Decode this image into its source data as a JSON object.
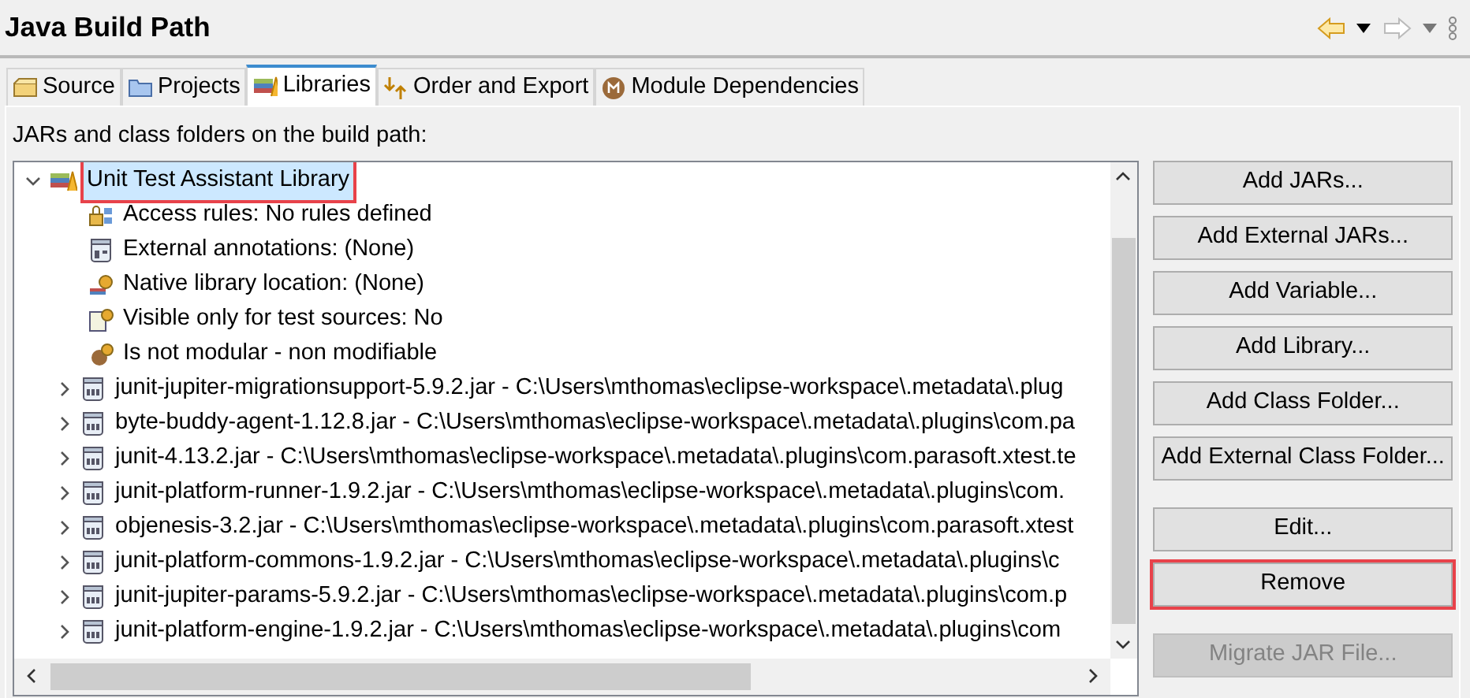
{
  "header": {
    "title": "Java Build Path"
  },
  "tabs": [
    {
      "label": "Source",
      "kind": "source",
      "selected": false
    },
    {
      "label": "Projects",
      "kind": "projects",
      "selected": false
    },
    {
      "label": "Libraries",
      "kind": "libraries",
      "selected": true
    },
    {
      "label": "Order and Export",
      "kind": "order",
      "selected": false
    },
    {
      "label": "Module Dependencies",
      "kind": "module",
      "selected": false
    }
  ],
  "panel": {
    "caption": "JARs and class folders on the build path:"
  },
  "tree": {
    "items": [
      {
        "label": "Unit Test Assistant Library",
        "kind": "library",
        "expanded": true,
        "selected": true,
        "highlighted": true,
        "children": [
          {
            "label": "Access rules: No rules defined",
            "kind": "access"
          },
          {
            "label": "External annotations: (None)",
            "kind": "annotations"
          },
          {
            "label": "Native library location: (None)",
            "kind": "native"
          },
          {
            "label": "Visible only for test sources: No",
            "kind": "visible"
          },
          {
            "label": "Is not modular - non modifiable",
            "kind": "modular"
          }
        ]
      },
      {
        "label": "junit-jupiter-migrationsupport-5.9.2.jar - C:\\Users\\mthomas\\eclipse-workspace\\.metadata\\.plug",
        "kind": "jar",
        "expanded": false,
        "selected": false,
        "highlighted": false
      },
      {
        "label": "byte-buddy-agent-1.12.8.jar - C:\\Users\\mthomas\\eclipse-workspace\\.metadata\\.plugins\\com.pa",
        "kind": "jar",
        "expanded": false,
        "selected": false,
        "highlighted": false
      },
      {
        "label": "junit-4.13.2.jar - C:\\Users\\mthomas\\eclipse-workspace\\.metadata\\.plugins\\com.parasoft.xtest.te",
        "kind": "jar",
        "expanded": false,
        "selected": false,
        "highlighted": false
      },
      {
        "label": "junit-platform-runner-1.9.2.jar - C:\\Users\\mthomas\\eclipse-workspace\\.metadata\\.plugins\\com.",
        "kind": "jar",
        "expanded": false,
        "selected": false,
        "highlighted": false
      },
      {
        "label": "objenesis-3.2.jar - C:\\Users\\mthomas\\eclipse-workspace\\.metadata\\.plugins\\com.parasoft.xtest",
        "kind": "jar",
        "expanded": false,
        "selected": false,
        "highlighted": false
      },
      {
        "label": "junit-platform-commons-1.9.2.jar - C:\\Users\\mthomas\\eclipse-workspace\\.metadata\\.plugins\\c",
        "kind": "jar",
        "expanded": false,
        "selected": false,
        "highlighted": false
      },
      {
        "label": "junit-jupiter-params-5.9.2.jar - C:\\Users\\mthomas\\eclipse-workspace\\.metadata\\.plugins\\com.p",
        "kind": "jar",
        "expanded": false,
        "selected": false,
        "highlighted": false
      },
      {
        "label": "junit-platform-engine-1.9.2.jar - C:\\Users\\mthomas\\eclipse-workspace\\.metadata\\.plugins\\com",
        "kind": "jar",
        "expanded": false,
        "selected": false,
        "highlighted": false
      }
    ]
  },
  "button_groups": [
    [
      {
        "label": "Add JARs...",
        "disabled": false,
        "highlighted": false
      },
      {
        "label": "Add External JARs...",
        "disabled": false,
        "highlighted": false
      },
      {
        "label": "Add Variable...",
        "disabled": false,
        "highlighted": false
      },
      {
        "label": "Add Library...",
        "disabled": false,
        "highlighted": false
      },
      {
        "label": "Add Class Folder...",
        "disabled": false,
        "highlighted": false
      },
      {
        "label": "Add External Class Folder...",
        "disabled": false,
        "highlighted": false
      }
    ],
    [
      {
        "label": "Edit...",
        "disabled": false,
        "highlighted": false
      },
      {
        "label": "Remove",
        "disabled": false,
        "highlighted": true
      }
    ],
    [
      {
        "label": "Migrate JAR File...",
        "disabled": true,
        "highlighted": false
      }
    ]
  ]
}
